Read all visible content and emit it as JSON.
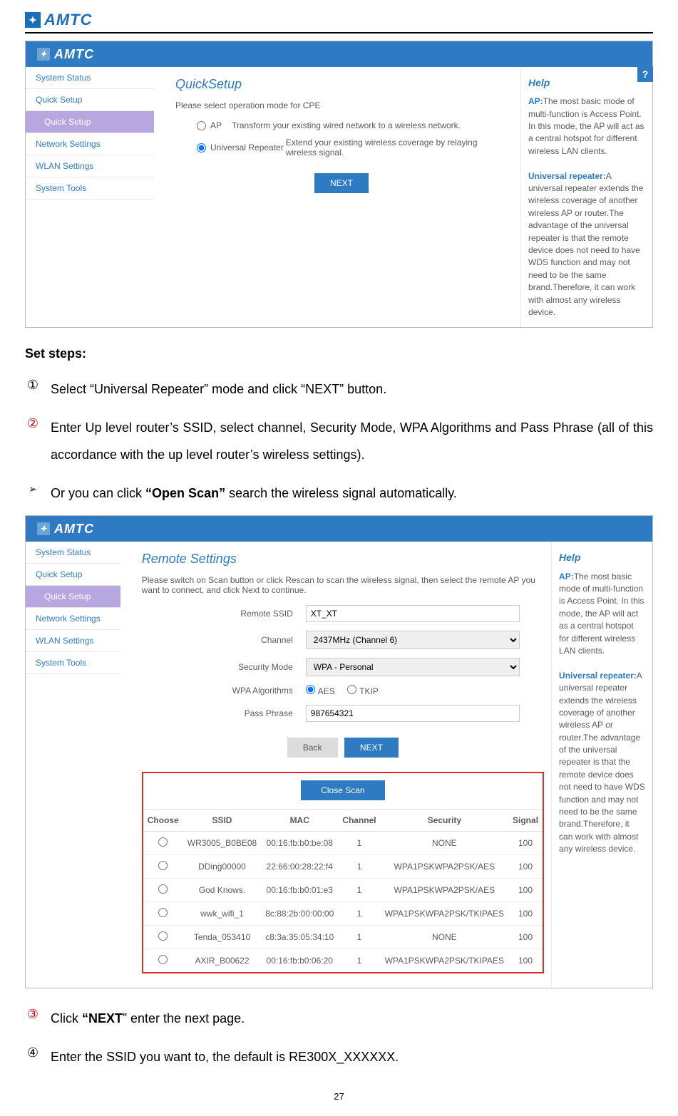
{
  "brand": "AMTC",
  "page_number": "27",
  "shot1": {
    "title": "QuickSetup",
    "intro": "Please select operation mode for CPE",
    "opt_ap": "AP",
    "opt_ap_desc": "Transform your existing wired network to a wireless network.",
    "opt_ur": "Universal Repeater",
    "opt_ur_desc": "Extend your existing wireless coverage by relaying wireless signal.",
    "next": "NEXT",
    "sidebar": [
      "System Status",
      "Quick Setup",
      "Quick Setup",
      "Network Settings",
      "WLAN Settings",
      "System Tools"
    ],
    "help_title": "Help",
    "help_ap_label": "AP:",
    "help_ap_body": "The most basic mode of multi-function is Access Point. In this mode, the AP will act as a central hotspot for different wireless LAN clients.",
    "help_ur_label": "Universal repeater:",
    "help_ur_body": "A universal repeater extends the wireless coverage of another wireless AP or router.The advantage of the universal repeater is that the remote device does not need to have WDS function and may not need to be the same brand.Therefore, it can work with almost any wireless device."
  },
  "text": {
    "set_steps": "Set steps:",
    "step1": "Select “Universal Repeater” mode and click “NEXT” button.",
    "step2": "Enter Up level router’s SSID, select channel, Security Mode, WPA Algorithms and Pass Phrase (all of this accordance with the up level router’s wireless settings).",
    "or_pre": "Or you can click ",
    "or_bold": "“Open Scan”",
    "or_post": " search the wireless signal automatically.",
    "step3_pre": "Click ",
    "step3_bold": "“NEXT",
    "step3_post": "” enter the next page.",
    "step4": "Enter the SSID you want to, the default is RE300X_XXXXXX."
  },
  "shot2": {
    "title": "Remote Settings",
    "intro": "Please switch on Scan button or click Rescan to scan the wireless signal, then select the remote AP you want to connect, and click Next to continue.",
    "sidebar": [
      "System Status",
      "Quick Setup",
      "Quick Setup",
      "Network Settings",
      "WLAN Settings",
      "System Tools"
    ],
    "lbl_ssid": "Remote SSID",
    "val_ssid": "XT_XT",
    "lbl_channel": "Channel",
    "val_channel": "2437MHz (Channel 6)",
    "lbl_sec": "Security Mode",
    "val_sec": "WPA - Personal",
    "lbl_algo": "WPA Algorithms",
    "algo_aes": "AES",
    "algo_tkip": "TKIP",
    "lbl_pass": "Pass Phrase",
    "val_pass": "987654321",
    "back": "Back",
    "next": "NEXT",
    "close_scan": "Close Scan",
    "cols": {
      "choose": "Choose",
      "ssid": "SSID",
      "mac": "MAC",
      "channel": "Channel",
      "security": "Security",
      "signal": "Signal"
    },
    "rows": [
      {
        "ssid": "WR3005_B0BE08",
        "mac": "00:16:fb:b0:be:08",
        "ch": "1",
        "sec": "NONE",
        "sig": "100"
      },
      {
        "ssid": "DDing00000",
        "mac": "22:66:00:28:22:f4",
        "ch": "1",
        "sec": "WPA1PSKWPA2PSK/AES",
        "sig": "100"
      },
      {
        "ssid": "God Knows.",
        "mac": "00:16:fb:b0:01:e3",
        "ch": "1",
        "sec": "WPA1PSKWPA2PSK/AES",
        "sig": "100"
      },
      {
        "ssid": "wwk_wifi_1",
        "mac": "8c:88:2b:00:00:00",
        "ch": "1",
        "sec": "WPA1PSKWPA2PSK/TKIPAES",
        "sig": "100"
      },
      {
        "ssid": "Tenda_053410",
        "mac": "c8:3a:35:05:34:10",
        "ch": "1",
        "sec": "NONE",
        "sig": "100"
      },
      {
        "ssid": "AXIR_B00622",
        "mac": "00:16:fb:b0:06:20",
        "ch": "1",
        "sec": "WPA1PSKWPA2PSK/TKIPAES",
        "sig": "100"
      }
    ],
    "help_title": "Help",
    "help_ap_label": "AP:",
    "help_ap_body": "The most basic mode of multi-function is Access Point. In this mode, the AP will act as a central hotspot for different wireless LAN clients.",
    "help_ur_label": "Universal repeater:",
    "help_ur_body": "A universal repeater extends the wireless coverage of another wireless AP or router.The advantage of the universal repeater is that the remote device does not need to have WDS function and may not need to be the same brand.Therefore, it can work with almost any wireless device."
  }
}
